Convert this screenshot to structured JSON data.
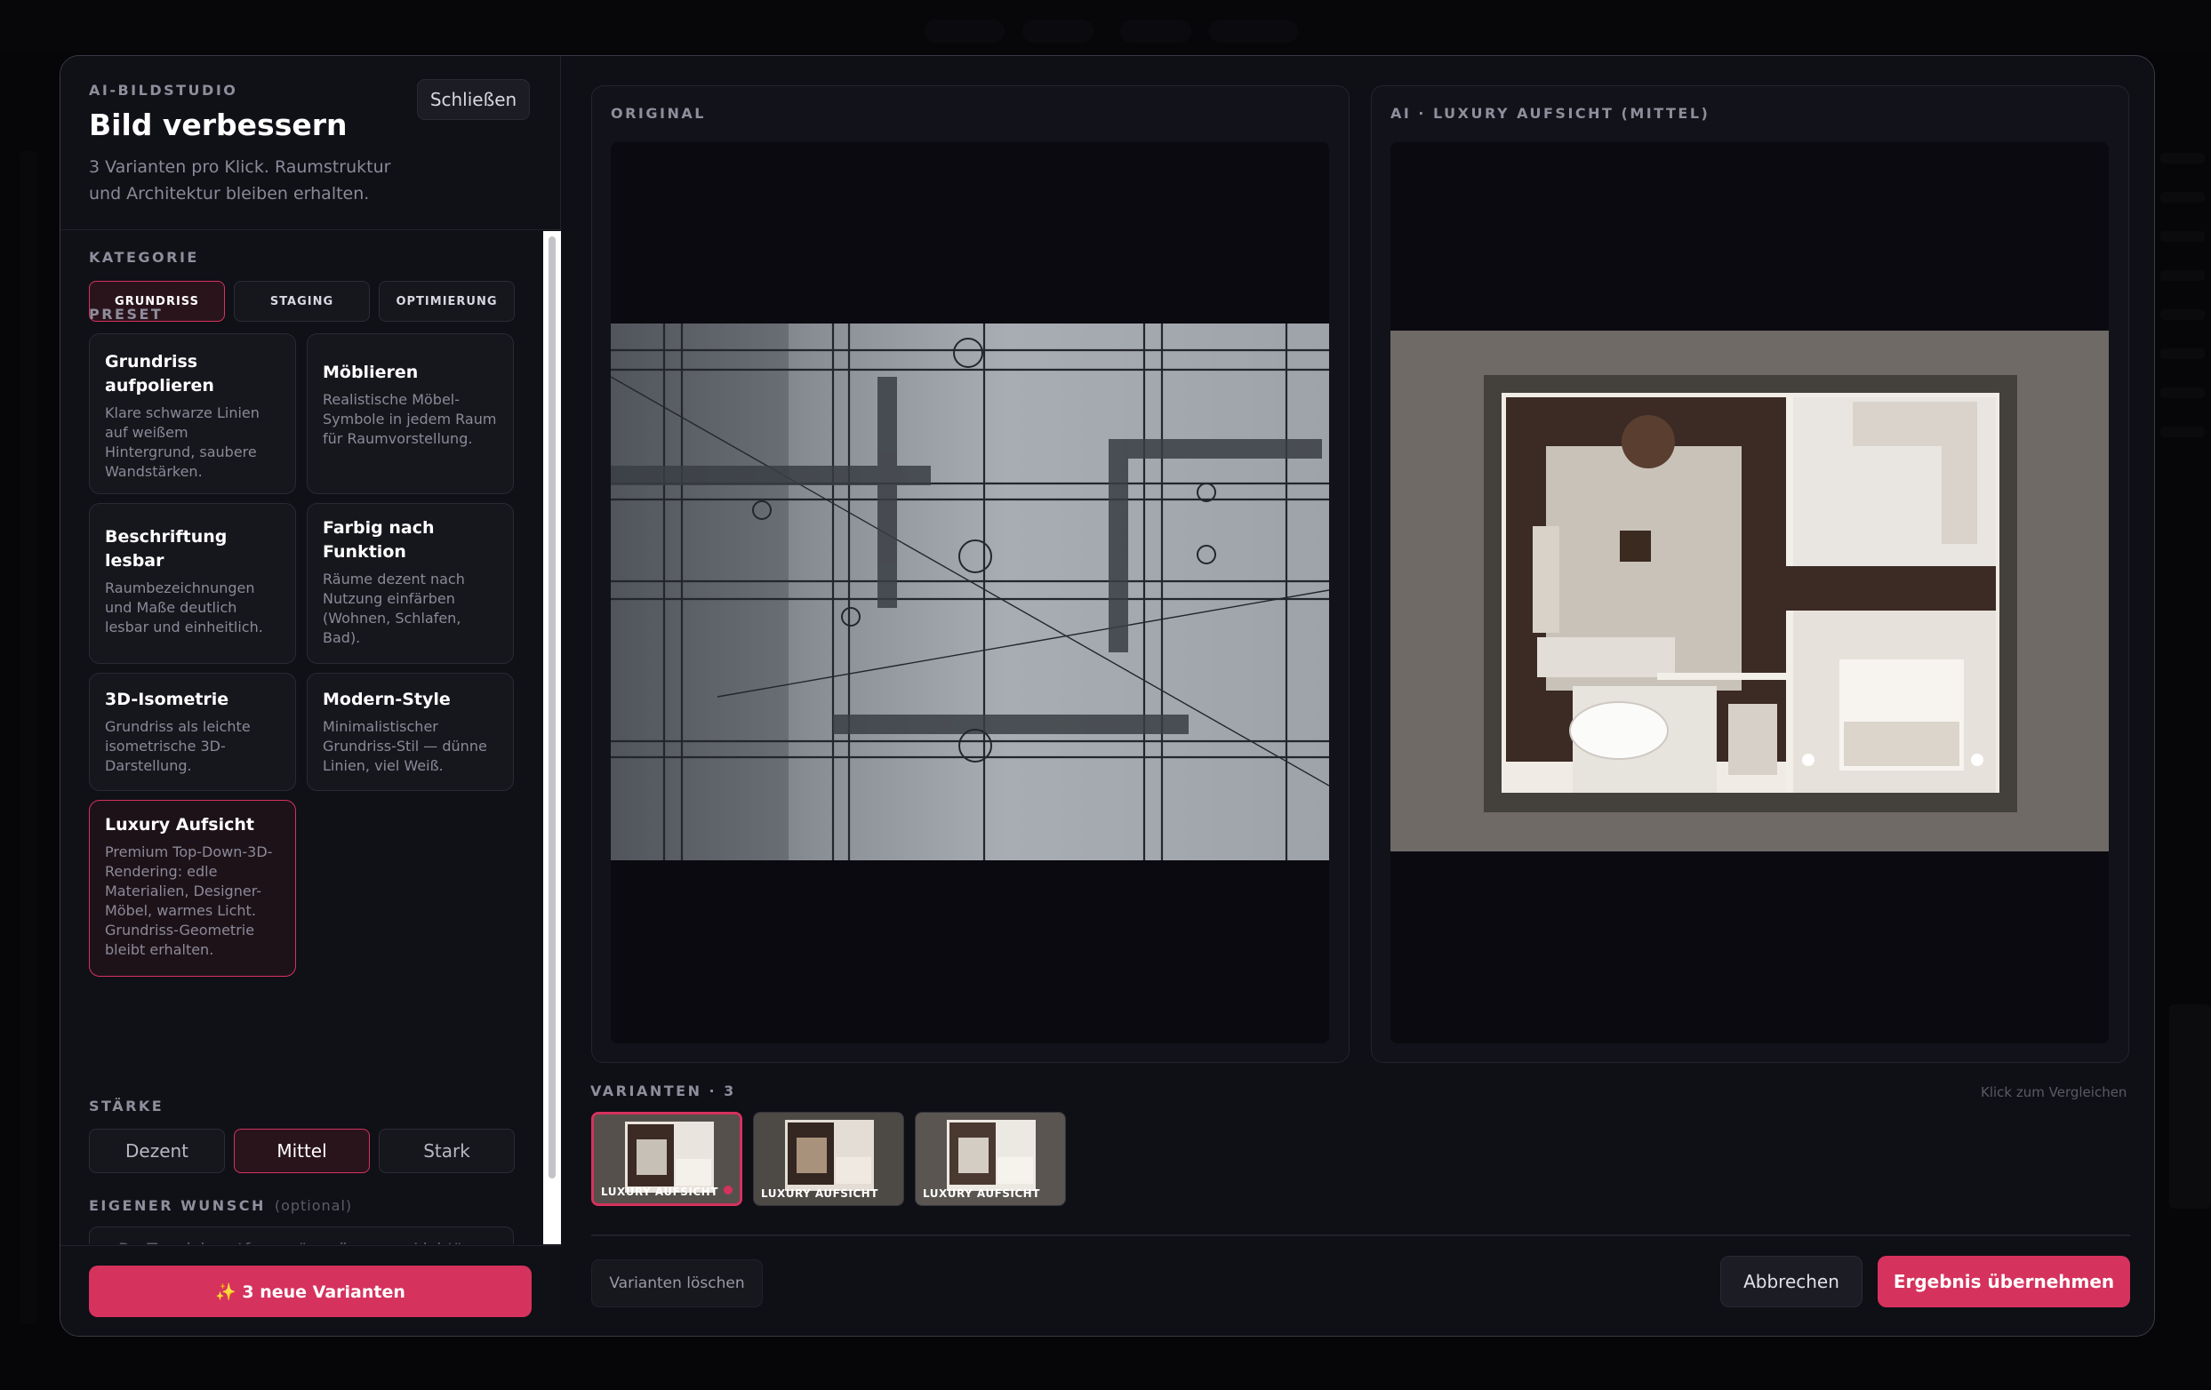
{
  "modal": {
    "eyebrow": "AI-BILDSTUDIO",
    "title": "Bild verbessern",
    "description": "3 Varianten pro Klick. Raumstruktur und Architektur bleiben erhalten.",
    "close_label": "Schließen"
  },
  "category": {
    "label": "KATEGORIE",
    "options": [
      "GRUNDRISS",
      "STAGING",
      "OPTIMIERUNG"
    ],
    "selected": "GRUNDRISS"
  },
  "preset": {
    "label": "PRESET",
    "items": [
      {
        "title": "Grundriss aufpolieren",
        "desc": "Klare schwarze Linien auf weißem Hintergrund, saubere Wandstärken."
      },
      {
        "title": "Möblieren",
        "desc": "Realistische Möbel-Symbole in jedem Raum für Raumvorstellung."
      },
      {
        "title": "Beschriftung lesbar",
        "desc": "Raumbezeichnungen und Maße deutlich lesbar und einheitlich."
      },
      {
        "title": "Farbig nach Funktion",
        "desc": "Räume dezent nach Nutzung einfärben (Wohnen, Schlafen, Bad)."
      },
      {
        "title": "3D-Isometrie",
        "desc": "Grundriss als leichte isometrische 3D-Darstellung."
      },
      {
        "title": "Modern-Style",
        "desc": "Minimalistischer Grundriss-Stil — dünne Linien, viel Weiß."
      },
      {
        "title": "Luxury Aufsicht",
        "desc": "Premium Top-Down-3D-Rendering: edle Materialien, Designer-Möbel, warmes Licht. Grundriss-Geometrie bleibt erhalten."
      }
    ],
    "selected": "Luxury Aufsicht"
  },
  "strength": {
    "label": "STÄRKE",
    "options": [
      "Dezent",
      "Mittel",
      "Stark"
    ],
    "selected": "Mittel"
  },
  "wish": {
    "label": "EIGENER WUNSCH",
    "optional": "(optional)",
    "placeholder": "z.B. „Teppich entfernen\", „wärmeres Licht\", „moderner Esstisch\", „weniger Gelbstich\""
  },
  "generate_label": "✨ 3 neue Varianten",
  "original_panel": {
    "title": "ORIGINAL"
  },
  "ai_panel": {
    "title": "AI · LUXURY AUFSICHT (MITTEL)"
  },
  "variants": {
    "label": "VARIANTEN · 3",
    "hint": "Klick zum Vergleichen",
    "items": [
      "LUXURY AUFSICHT",
      "LUXURY AUFSICHT",
      "LUXURY AUFSICHT"
    ],
    "selected_index": 0
  },
  "actions": {
    "delete_variants": "Varianten löschen",
    "cancel": "Abbrechen",
    "accept": "Ergebnis übernehmen"
  },
  "colors": {
    "accent": "#d6325e",
    "panel": "#12121a",
    "modal_bg": "#0f0f16"
  }
}
